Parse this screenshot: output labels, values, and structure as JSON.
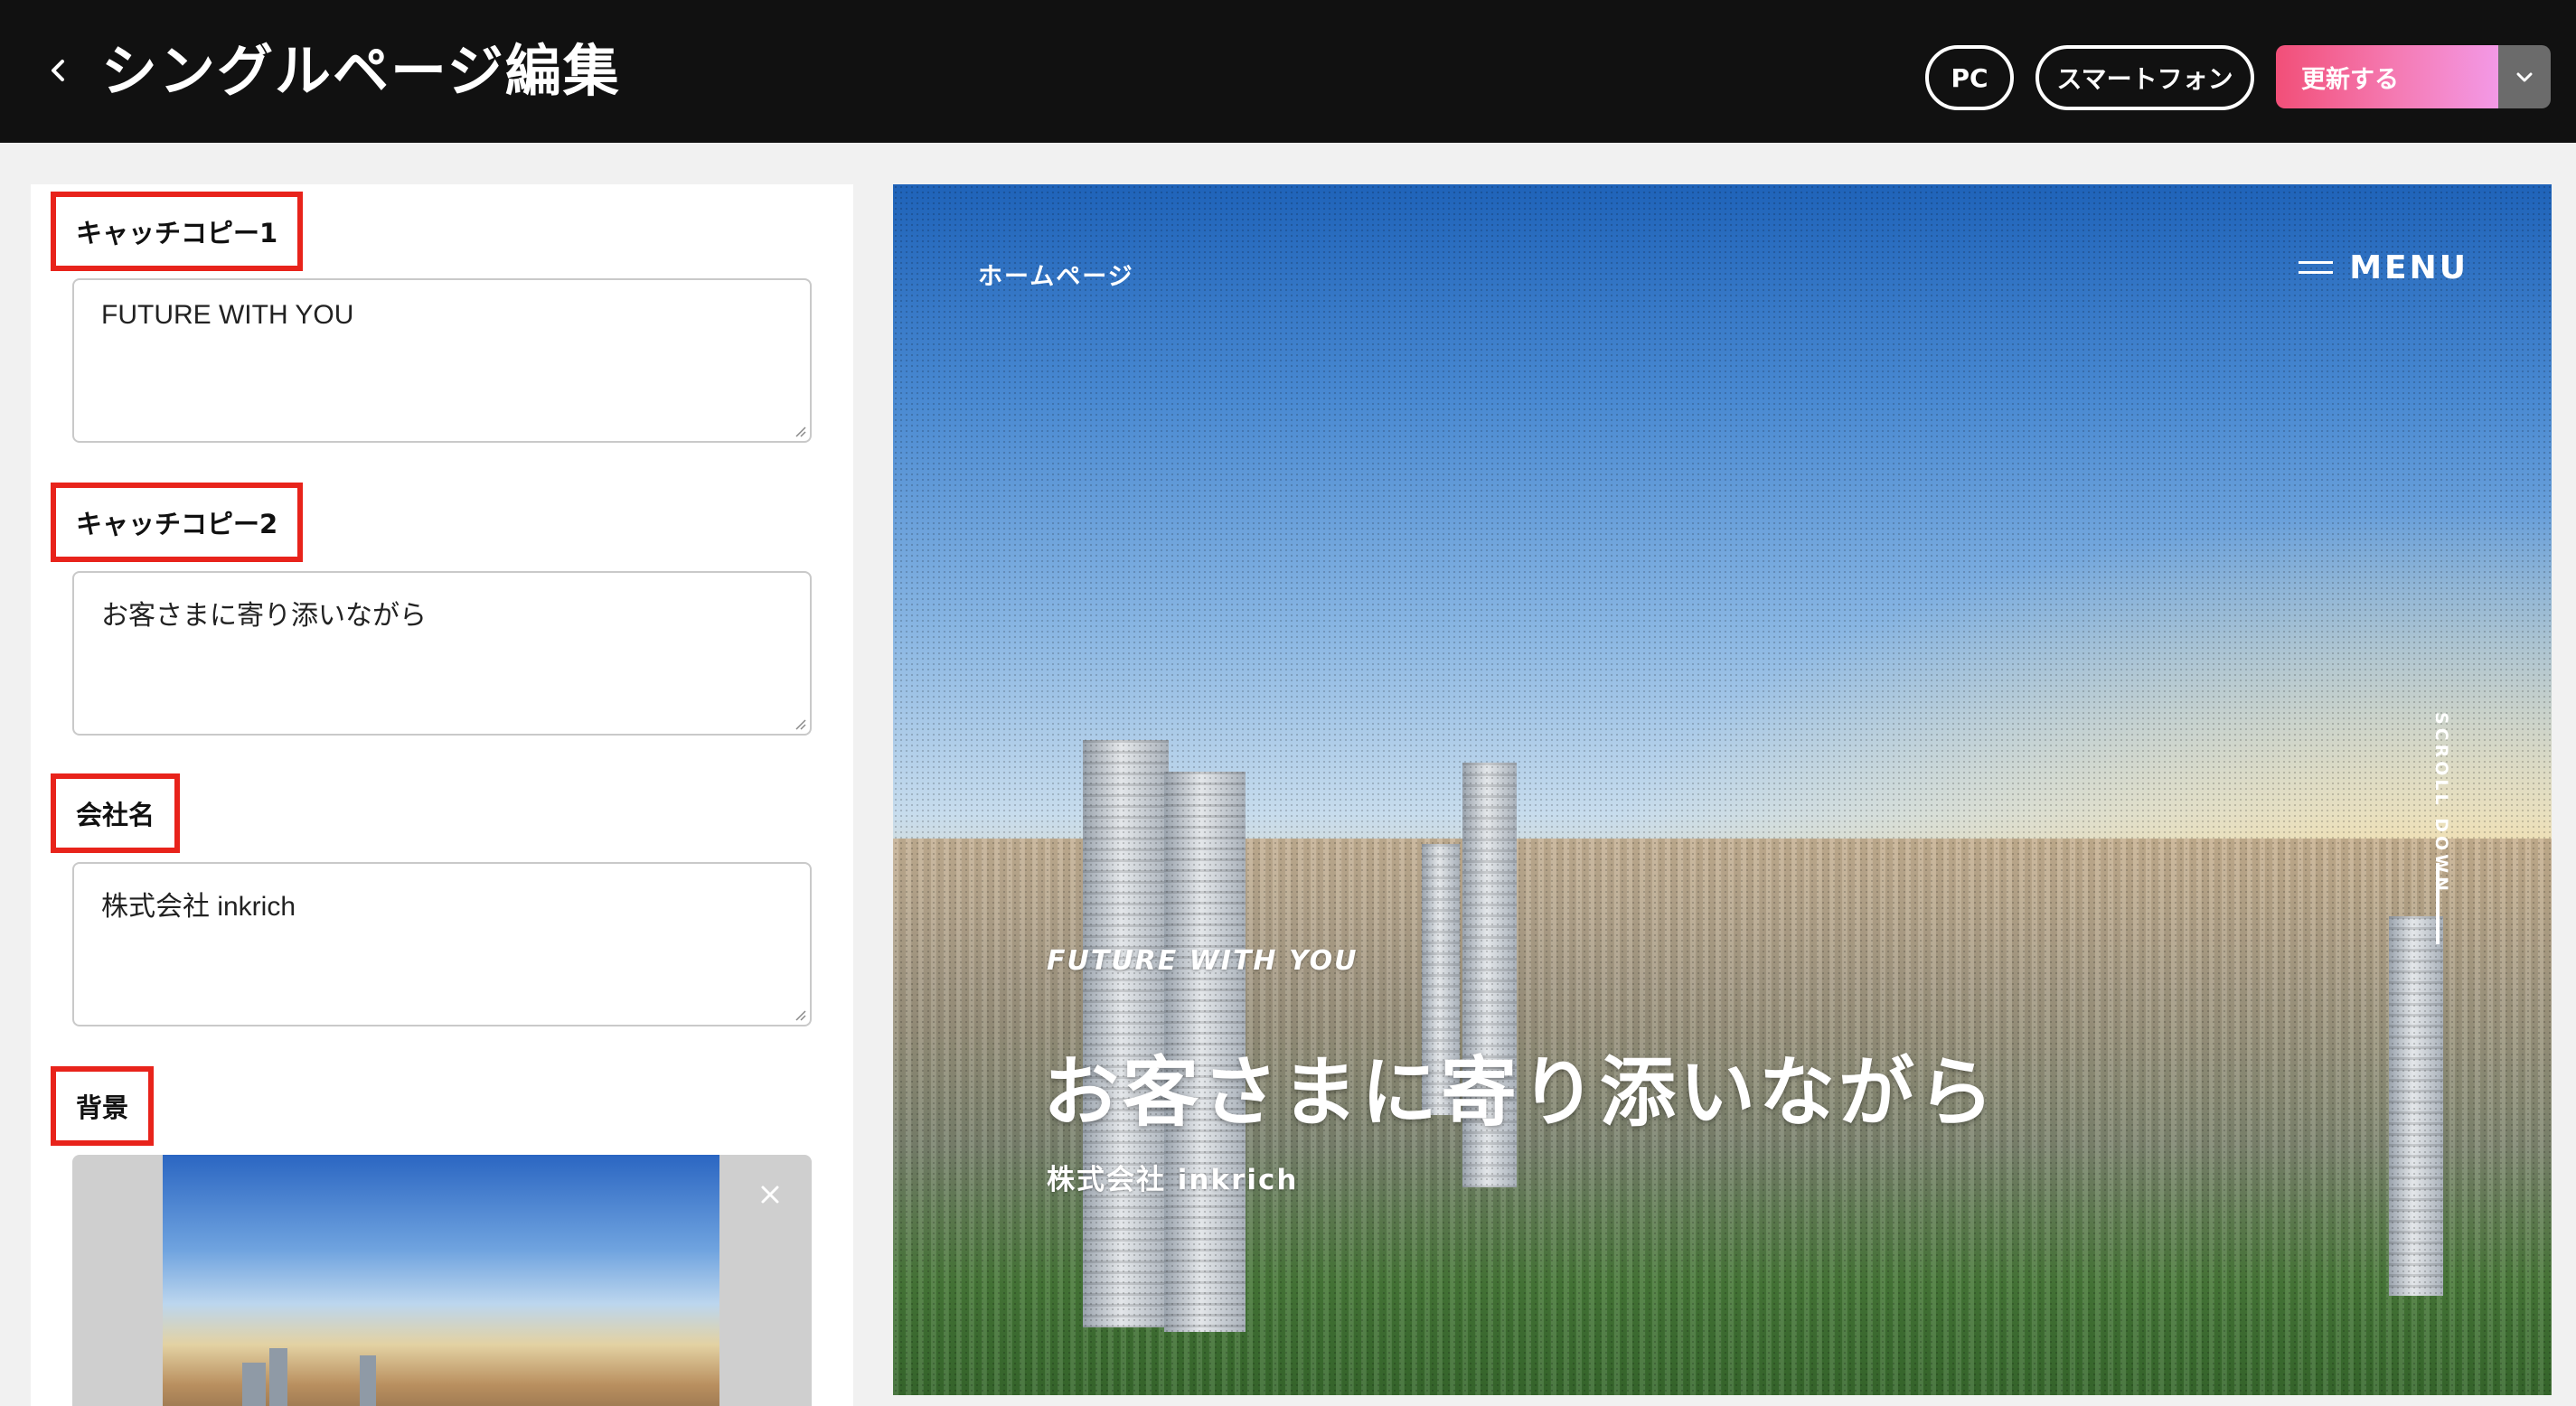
{
  "header": {
    "title": "シングルページ編集",
    "buttons": {
      "pc": "PC",
      "smartphone": "スマートフォン",
      "update": "更新する"
    }
  },
  "editor": {
    "fields": [
      {
        "label": "キャッチコピー1",
        "value": "FUTURE WITH YOU"
      },
      {
        "label": "キャッチコピー2",
        "value": "お客さまに寄り添いながら"
      },
      {
        "label": "会社名",
        "value": "株式会社 inkrich"
      },
      {
        "label": "背景"
      }
    ]
  },
  "preview": {
    "nav_home": "ホームページ",
    "menu": "MENU",
    "scroll": "SCROLL DOWN",
    "catch1": "FUTURE WITH YOU",
    "catch2": "お客さまに寄り添いながら",
    "company": "株式会社 inkrich"
  },
  "colors": {
    "header_bg": "#111111",
    "highlight_border": "#e8231b",
    "update_gradient_start": "#f24f78",
    "update_gradient_end": "#f399e6"
  },
  "icons": [
    "chevron-left-icon",
    "chevron-down-icon",
    "close-icon",
    "hamburger-icon"
  ]
}
